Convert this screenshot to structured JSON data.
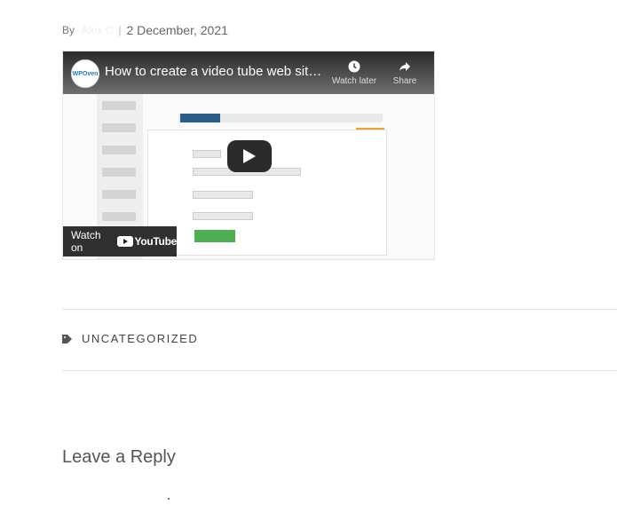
{
  "post_meta": {
    "by_label": "By",
    "author": "Alex C",
    "separator": "|",
    "date": "2 December, 2021"
  },
  "video": {
    "title": "How to create a video tube web site usi...",
    "channel_logo_text": "WPOven",
    "watch_later_label": "Watch later",
    "share_label": "Share",
    "watch_on_label": "Watch on",
    "youtube_label": "YouTube",
    "icons": [
      "clock-icon",
      "share-icon",
      "play-icon",
      "youtube-logo-icon"
    ]
  },
  "categories": {
    "icon": "tag-icon",
    "label": "UNCATEGORIZED"
  },
  "comments": {
    "heading": "Leave a Reply"
  },
  "colors": {
    "video_overlay": "#2b2b2b",
    "accent_green": "#4caf50",
    "accent_orange": "#f0a030",
    "divider": "#e6e6e6"
  }
}
